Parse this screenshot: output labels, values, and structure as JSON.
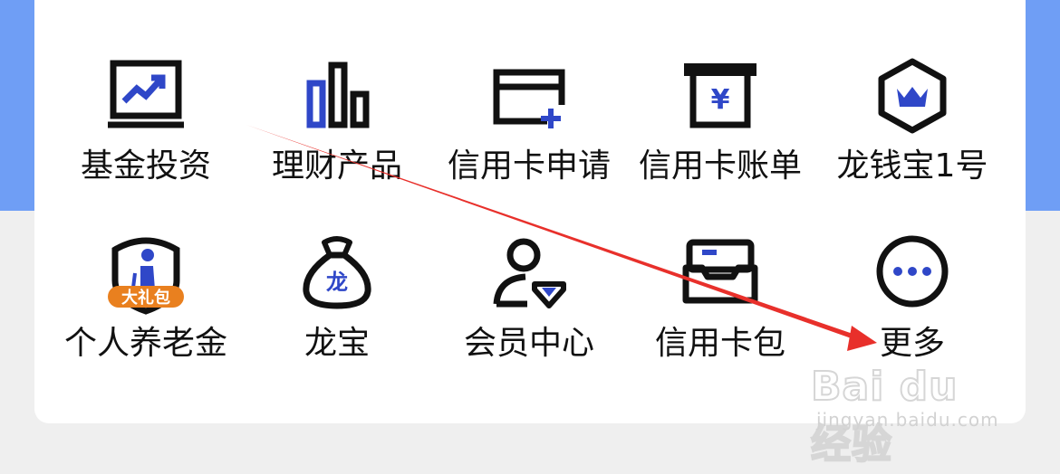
{
  "colors": {
    "background": "#efefef",
    "header_band": "#6f9ef5",
    "card": "#ffffff",
    "icon_stroke": "#111111",
    "icon_accent": "#2f47c8",
    "badge_orange": "#e9801f",
    "annotation_arrow": "#e8302b"
  },
  "grid": {
    "items": [
      {
        "label": "基金投资",
        "icon": "chart-trend-icon"
      },
      {
        "label": "理财产品",
        "icon": "bar-chart-icon"
      },
      {
        "label": "信用卡申请",
        "icon": "card-add-icon"
      },
      {
        "label": "信用卡账单",
        "icon": "yen-bill-icon"
      },
      {
        "label": "龙钱宝1号",
        "icon": "crown-hexagon-icon"
      },
      {
        "label": "个人养老金",
        "icon": "elder-shield-icon",
        "badge": "大礼包"
      },
      {
        "label": "龙宝",
        "icon": "money-bag-icon",
        "glyph": "龙"
      },
      {
        "label": "会员中心",
        "icon": "member-diamond-icon"
      },
      {
        "label": "信用卡包",
        "icon": "card-wallet-icon"
      },
      {
        "label": "更多",
        "icon": "more-dots-icon"
      }
    ]
  },
  "watermark": {
    "brand": "Bai du 经验",
    "url": "jingyan.baidu.com"
  }
}
